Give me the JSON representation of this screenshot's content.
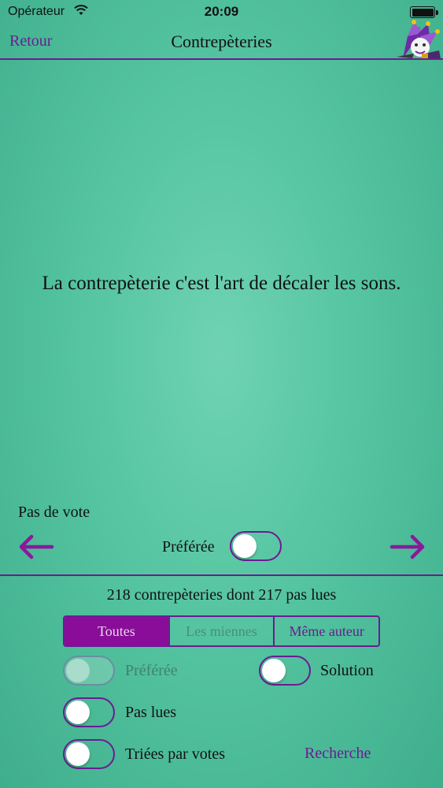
{
  "status_bar": {
    "carrier": "Opérateur",
    "time": "20:09"
  },
  "nav": {
    "back_label": "Retour",
    "title": "Contrepèteries"
  },
  "content": {
    "message": "La contrepèterie c'est l'art de décaler les sons."
  },
  "vote": {
    "status": "Pas de vote",
    "favorite_label": "Préférée",
    "favorite_on": false
  },
  "collection": {
    "summary": "218 contrepèteries dont 217 pas lues"
  },
  "filter_tabs": {
    "all": "Toutes",
    "mine": "Les miennes",
    "same_author": "Même auteur",
    "selected": "Toutes"
  },
  "options": {
    "favorite": "Préférée",
    "solution": "Solution",
    "unread": "Pas lues",
    "sorted_by_votes": "Triées par votes",
    "search": "Recherche"
  },
  "colors": {
    "accent": "#6b1c93",
    "selected_tab": "#8a0d99",
    "background": "#55c4a0"
  },
  "icons": [
    "wifi-icon",
    "battery-icon",
    "jester-logo",
    "arrow-left-icon",
    "arrow-right-icon"
  ]
}
